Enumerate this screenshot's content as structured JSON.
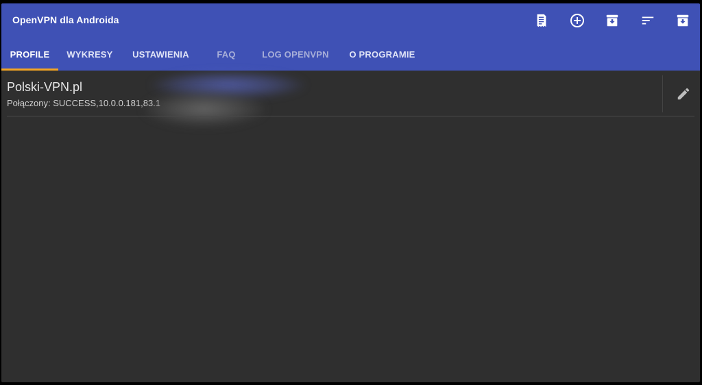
{
  "app": {
    "title": "OpenVPN dla Androida"
  },
  "toolbar": {
    "actions": [
      {
        "icon": "receipt-icon"
      },
      {
        "icon": "add-circle-icon"
      },
      {
        "icon": "import-archive-icon"
      },
      {
        "icon": "sort-icon"
      },
      {
        "icon": "download-archive-icon"
      }
    ]
  },
  "tabs": [
    {
      "label": "PROFILE",
      "active": true
    },
    {
      "label": "WYKRESY",
      "active": false
    },
    {
      "label": "USTAWIENIA",
      "active": false
    },
    {
      "label": "FAQ",
      "active": false
    },
    {
      "label": "LOG OPENVPN",
      "active": false
    },
    {
      "label": "O PROGRAMIE",
      "active": false
    }
  ],
  "profiles": [
    {
      "name": "Polski-VPN.pl",
      "status": "Połączony: SUCCESS,10.0.0.181,83.1"
    }
  ],
  "colors": {
    "appbar": "#3f51b5",
    "tab_indicator": "#f5a623",
    "background": "#2f2f2f",
    "text_primary": "#e6e6e6"
  }
}
